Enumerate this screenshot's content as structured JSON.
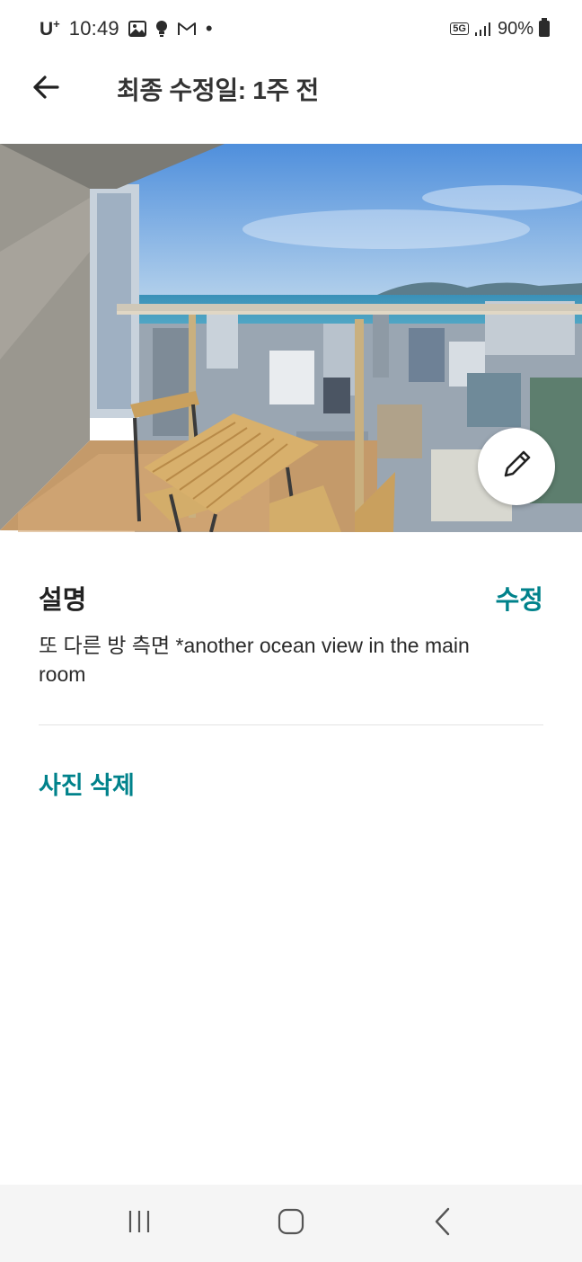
{
  "status_bar": {
    "carrier": "U",
    "carrier_sup": "+",
    "time": "10:49",
    "dot": "•",
    "network": "5G",
    "battery": "90%",
    "icons": [
      "gallery-icon",
      "notification-bulb-icon",
      "gmail-icon",
      "signal-icon",
      "battery-icon"
    ]
  },
  "header": {
    "title": "최종 수정일: 1주 전",
    "back_icon": "arrow-left-icon"
  },
  "photo": {
    "alt": "balcony ocean view photo",
    "edit_icon": "pencil-icon"
  },
  "description_section": {
    "title": "설명",
    "edit_label": "수정",
    "text": "또 다른 방 측면 *another ocean view in the main room"
  },
  "actions": {
    "delete_label": "사진 삭제"
  },
  "nav_bar": {
    "icons": [
      "recent-apps-icon",
      "home-icon",
      "back-icon"
    ]
  },
  "colors": {
    "accent": "#00828b",
    "text": "#222222",
    "nav_bg": "#f5f5f5"
  }
}
